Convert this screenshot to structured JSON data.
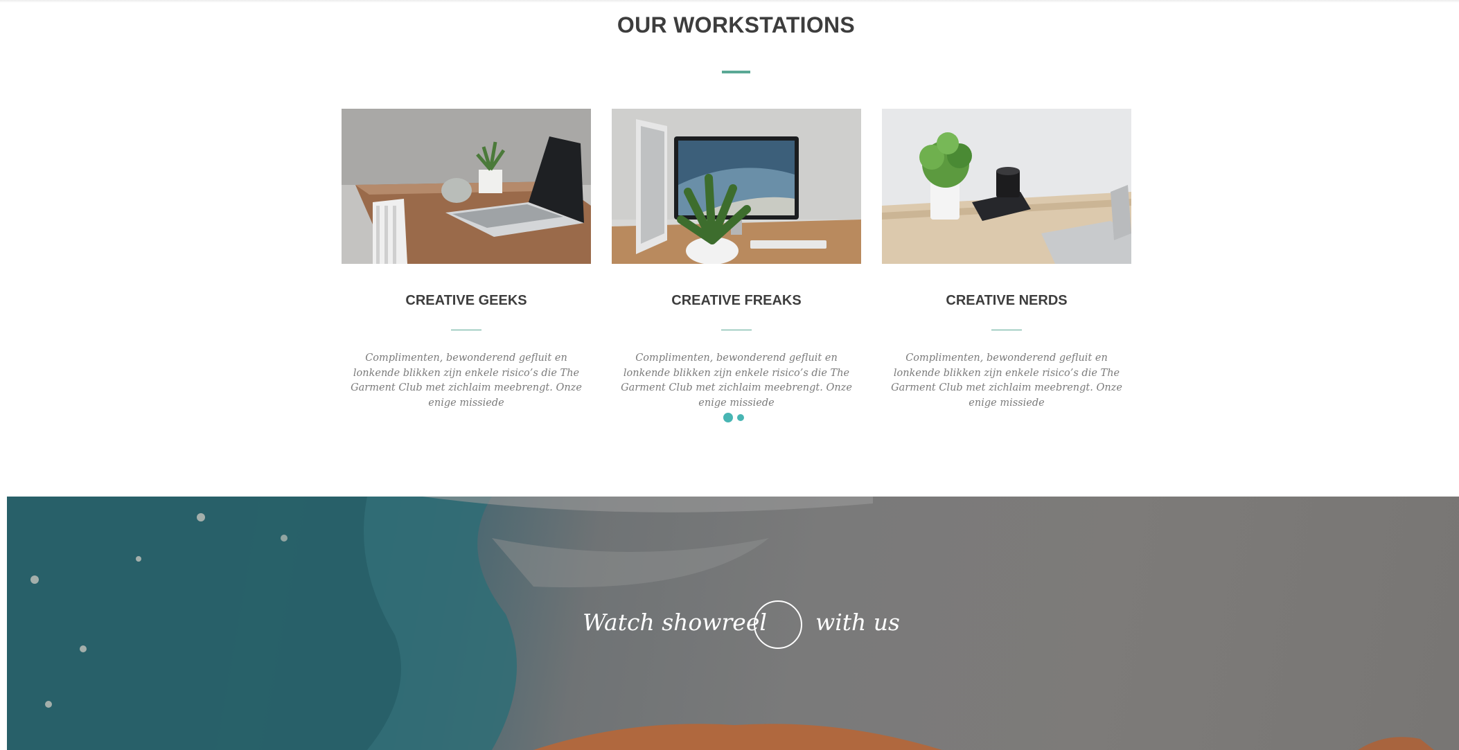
{
  "section": {
    "title": "OUR WORKSTATIONS",
    "accent_color": "#5aa895"
  },
  "cards": [
    {
      "image": "laptop-desk-photo",
      "title": "CREATIVE GEEKS",
      "text": "Complimenten, bewonderend gefluit en lonkende blikken zijn enkele risico’s die The Garment Club met zichlaim meebrengt. Onze enige missiede"
    },
    {
      "image": "imac-desk-photo",
      "title": "CREATIVE FREAKS",
      "text": "Complimenten, bewonderend gefluit en lonkende blikken zijn enkele risico’s die The Garment Club met zichlaim meebrengt. Onze enige missiede"
    },
    {
      "image": "plant-camera-desk-photo",
      "title": "CREATIVE NERDS",
      "text": "Complimenten, bewonderend gefluit en lonkende blikken zijn enkele risico’s die The Garment Club met zichlaim meebrengt. Onze enige missiede"
    }
  ],
  "carousel": {
    "dot_color": "#48b5b3"
  },
  "showreel": {
    "text_before": "Watch showreel",
    "text_after": "with us",
    "icon": "play-circle-icon"
  }
}
